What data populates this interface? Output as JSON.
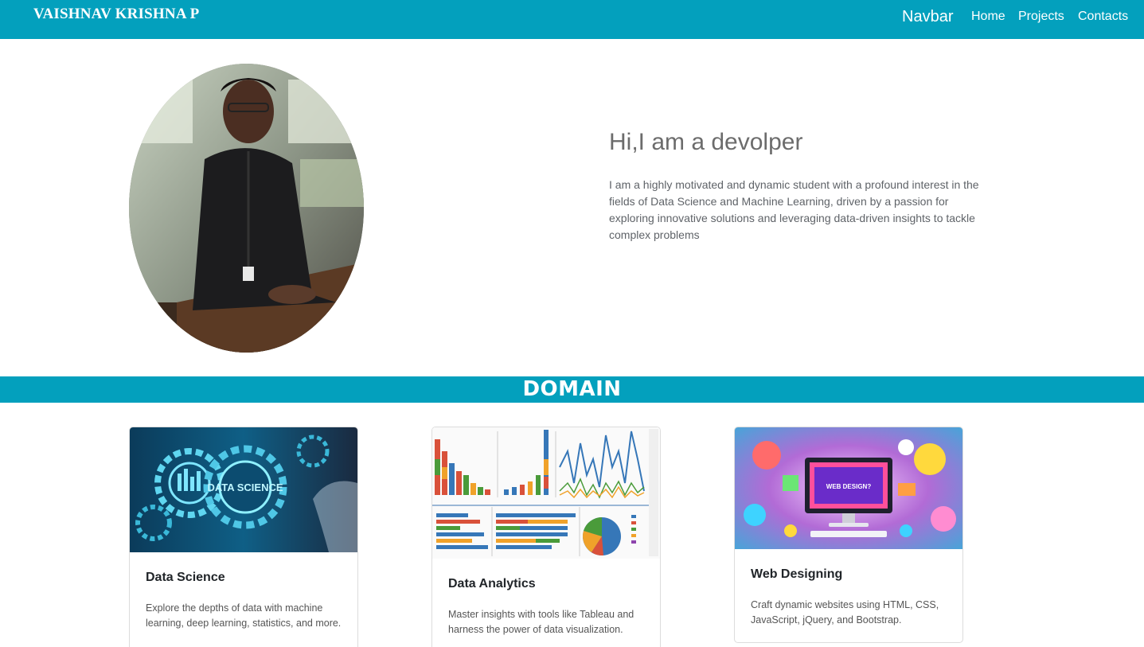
{
  "navbar": {
    "brand": "VAISHNAV KRISHNA P",
    "title": "Navbar",
    "links": [
      "Home",
      "Projects",
      "Contacts"
    ]
  },
  "hero": {
    "heading": "Hi,I am a devolper",
    "description": "I am a highly motivated and dynamic student with a profound interest in the fields of Data Science and Machine Learning, driven by a passion for exploring innovative solutions and leveraging data-driven insights to tackle complex problems"
  },
  "domain": {
    "heading": "DOMAIN",
    "cards": [
      {
        "title": "Data Science",
        "text": "Explore the depths of data with machine learning, deep learning, statistics, and more."
      },
      {
        "title": "Data Analytics",
        "text": "Master insights with tools like Tableau and harness the power of data visualization."
      },
      {
        "title": "Web Designing",
        "text": "Craft dynamic websites using HTML, CSS, JavaScript, jQuery, and Bootstrap."
      }
    ]
  },
  "images": {
    "ds_overlay_text": "DATA SCIENCE",
    "wd_screen_text": "WEB DESIGN?"
  },
  "colors": {
    "accent": "#03a0bd",
    "white": "#ffffff"
  }
}
